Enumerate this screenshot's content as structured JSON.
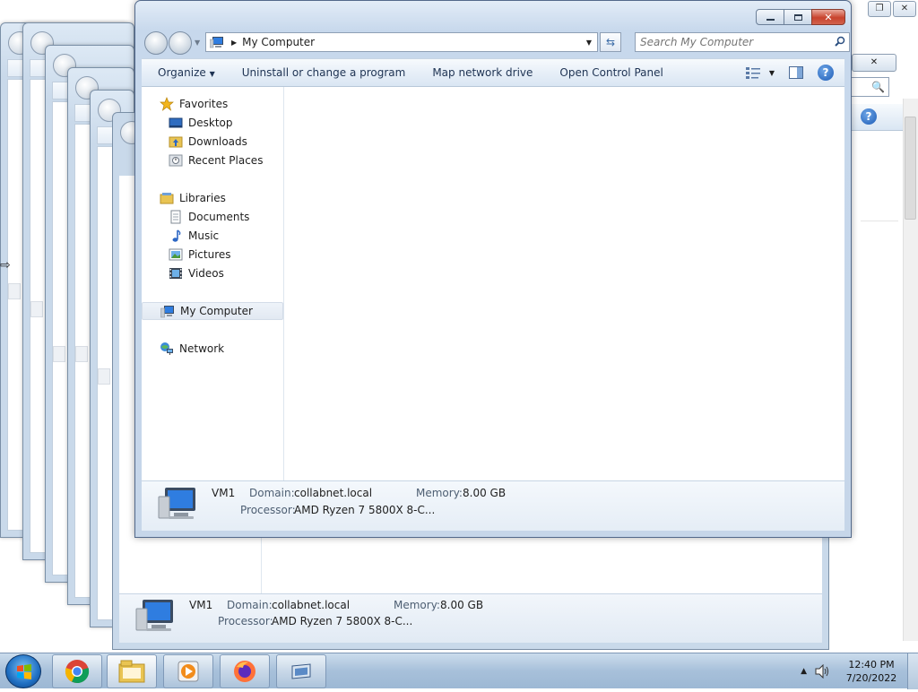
{
  "window": {
    "address_location": "My Computer",
    "search_placeholder": "Search My Computer",
    "caption": {
      "minimize": "—",
      "maximize": "□",
      "close": "✕"
    }
  },
  "toolbar": {
    "organize": "Organize",
    "uninstall": "Uninstall or change a program",
    "map_drive": "Map network drive",
    "control_panel": "Open Control Panel"
  },
  "navpane": {
    "favorites": "Favorites",
    "desktop": "Desktop",
    "downloads": "Downloads",
    "recent_places": "Recent Places",
    "libraries": "Libraries",
    "documents": "Documents",
    "music": "Music",
    "pictures": "Pictures",
    "videos": "Videos",
    "my_computer": "My Computer",
    "network": "Network"
  },
  "details": {
    "computer_name": "VM1",
    "domain_label": "Domain:",
    "domain_value": "collabnet.local",
    "memory_label": "Memory:",
    "memory_value": "8.00 GB",
    "processor_label": "Processor:",
    "processor_value": "AMD Ryzen 7 5800X 8-C..."
  },
  "taskbar": {
    "time": "12:40 PM",
    "date": "7/20/2022",
    "apps": [
      "chrome-icon",
      "explorer-icon",
      "media-player-icon",
      "firefox-icon",
      "window-switcher-icon"
    ]
  },
  "colors": {
    "accent": "#3a6aa6",
    "close_button": "#c8432d",
    "selected_nav": "#e2e9f2"
  }
}
